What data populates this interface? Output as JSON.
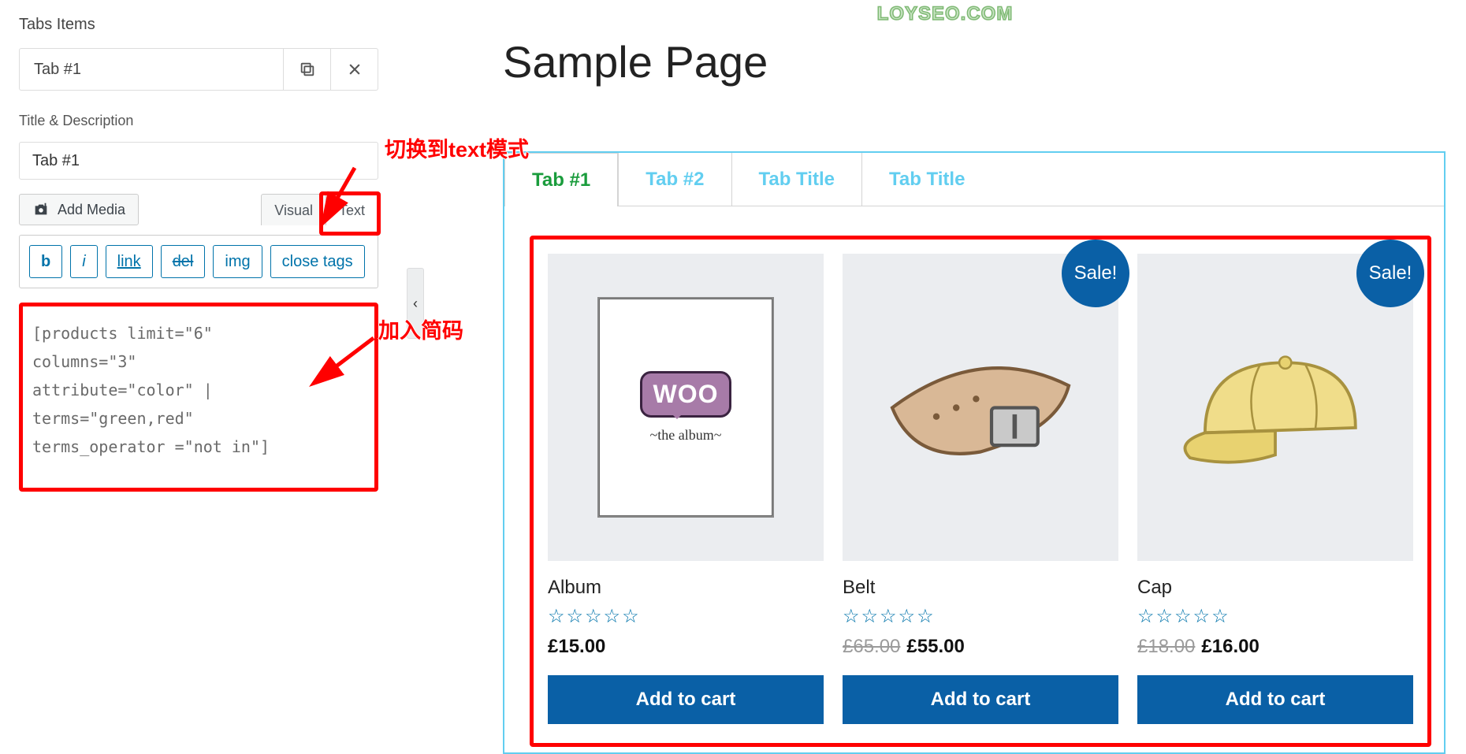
{
  "sidebar": {
    "section_label": "Tabs Items",
    "tab_item_title": "Tab #1",
    "title_desc_label": "Title & Description",
    "title_input_value": "Tab #1",
    "add_media_label": "Add Media",
    "mode_visual": "Visual",
    "mode_text": "Text",
    "toolbar": {
      "b": "b",
      "i": "i",
      "link": "link",
      "del": "del",
      "img": "img",
      "close": "close tags"
    },
    "code": "[products limit=\"6\"\ncolumns=\"3\"\nattribute=\"color\" |\nterms=\"green,red\"\nterms_operator =\"not in\"]"
  },
  "annotations": {
    "switch_text": "切换到text模式",
    "add_shortcode": "加入简码"
  },
  "collapse_glyph": "‹",
  "preview": {
    "watermark": "LOYSEO.COM",
    "page_title": "Sample Page",
    "tabs": [
      "Tab #1",
      "Tab #2",
      "Tab Title",
      "Tab Title"
    ],
    "sale_label": "Sale!",
    "add_to_cart": "Add to cart",
    "stars": "☆☆☆☆☆",
    "woo_text": "WOO",
    "woo_sub": "~the   album~",
    "products": [
      {
        "name": "Album",
        "price": "£15.00",
        "old": "",
        "sale": false
      },
      {
        "name": "Belt",
        "price": "£55.00",
        "old": "£65.00",
        "sale": true
      },
      {
        "name": "Cap",
        "price": "£16.00",
        "old": "£18.00",
        "sale": true
      }
    ]
  }
}
